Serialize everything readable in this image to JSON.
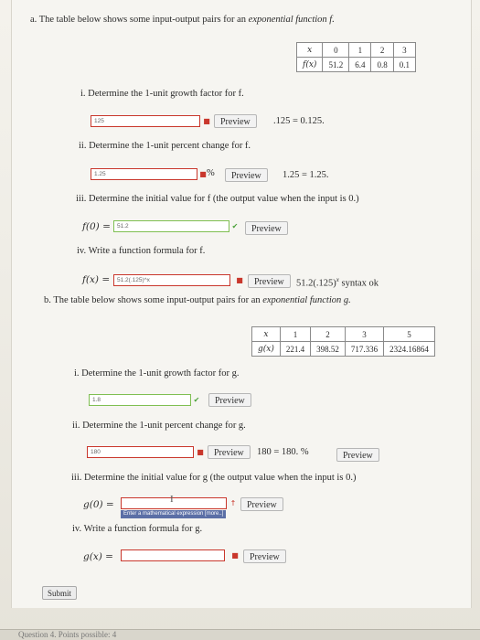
{
  "part_a": {
    "label": "a.",
    "intro": "The table below shows some input-output pairs for an",
    "intro_emph": "exponential function f.",
    "table_header_x": "x",
    "table_header_fx": "f(x)",
    "x_values": [
      "0",
      "1",
      "2",
      "3"
    ],
    "fx_values": [
      "51.2",
      "6.4",
      "0.8",
      "0.1"
    ],
    "q1": {
      "label": "i.",
      "text": "Determine the 1-unit growth factor for f.",
      "value": "125",
      "preview_label": "Preview",
      "preview_text": ".125 = 0.125."
    },
    "q2": {
      "label": "ii.",
      "text": "Determine the 1-unit percent change for f.",
      "value": "1.25",
      "suffix": "%",
      "preview_label": "Preview",
      "preview_text": "1.25 = 1.25."
    },
    "q3": {
      "label": "iii.",
      "text": "Determine the initial value for f (the output value when the input is 0.)",
      "lhs": "f(0) =",
      "value": "51.2",
      "preview_label": "Preview"
    },
    "q4": {
      "label": "iv.",
      "text": "Write a function formula for f.",
      "lhs": "f(x) =",
      "value": "51.2(.125)^x",
      "preview_label": "Preview",
      "preview_text": "51.2(.125)",
      "preview_sup": "x",
      "preview_note": "syntax ok"
    }
  },
  "part_b": {
    "label": "b.",
    "intro": "The table below shows some input-output pairs for an",
    "intro_emph": "exponential function g.",
    "table_header_x": "x",
    "table_header_gx": "g(x)",
    "x_values": [
      "1",
      "2",
      "3",
      "5"
    ],
    "gx_values": [
      "221.4",
      "398.52",
      "717.336",
      "2324.16864"
    ],
    "q1": {
      "label": "i.",
      "text": "Determine the 1-unit growth factor for g.",
      "value": "1.8",
      "preview_label": "Preview"
    },
    "q2": {
      "label": "ii.",
      "text": "Determine the 1-unit percent change for g.",
      "value": "180",
      "preview_label": "Preview",
      "preview_text": "180 = 180. %",
      "preview2_label": "Preview"
    },
    "q3": {
      "label": "iii.",
      "text": "Determine the initial value for g (the output value when the input is 0.)",
      "lhs": "g(0) =",
      "value": "",
      "preview_label": "Preview",
      "tooltip": "Enter a mathematical expression [more..]"
    },
    "q4": {
      "label": "iv.",
      "text": "Write a function formula for g.",
      "lhs": "g(x) =",
      "value": "",
      "preview_label": "Preview"
    }
  },
  "submit_label": "Submit",
  "footer_text": "Question 4. Points possible: 4",
  "colors": {
    "error_border": "#c9372c",
    "ok_border": "#7fbf52",
    "ok_check": "#4aa13a",
    "tooltip_bg": "#5b6fa6"
  }
}
